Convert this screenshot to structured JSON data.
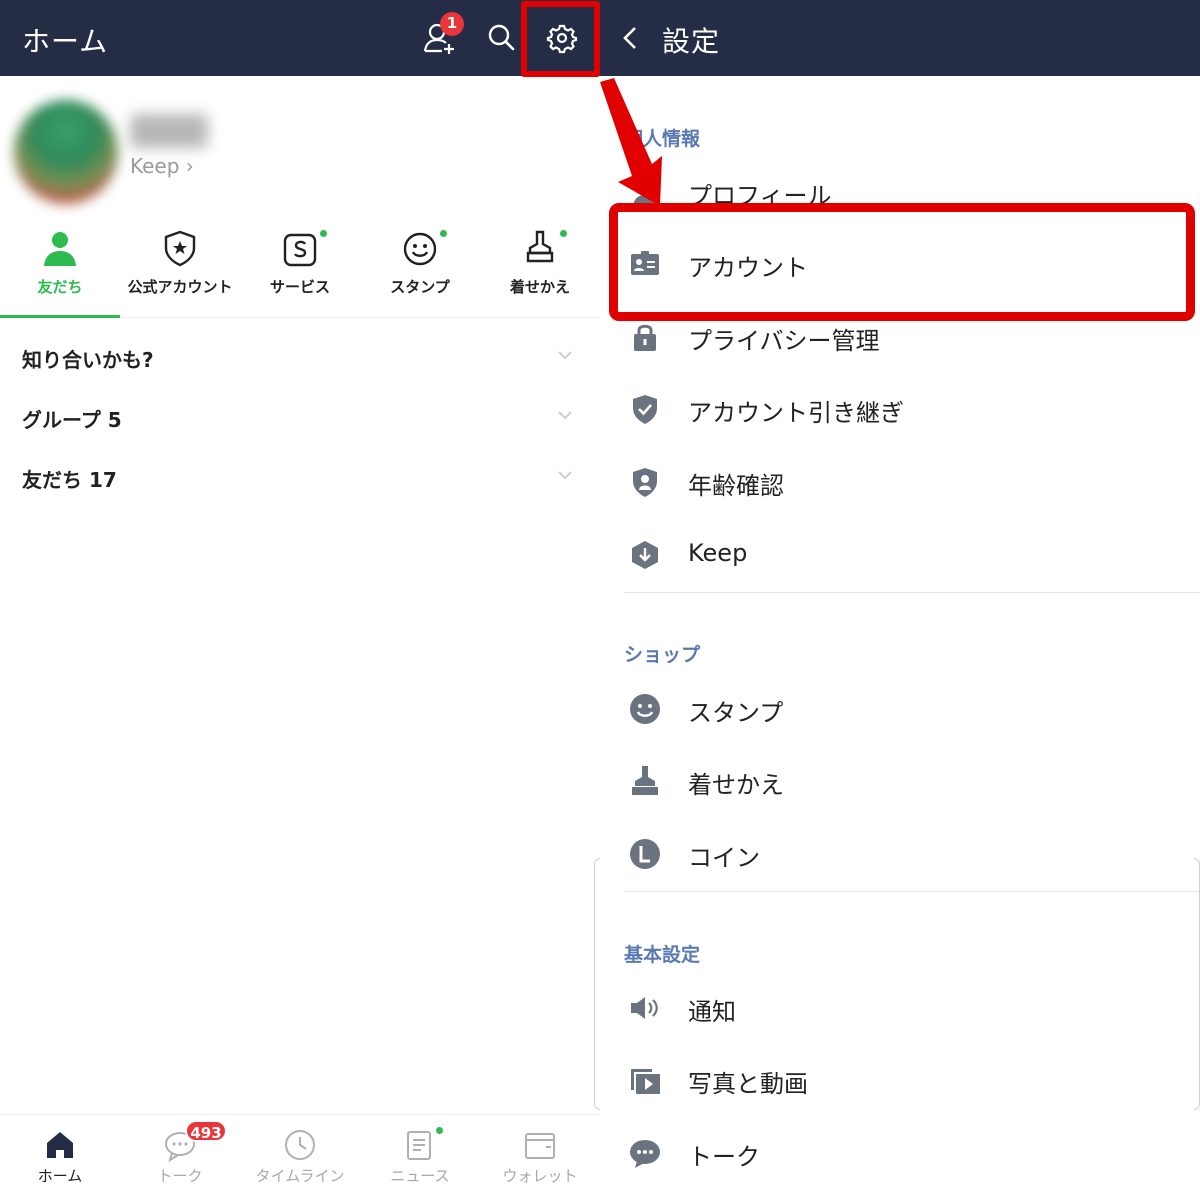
{
  "home": {
    "title": "ホーム",
    "add_friend_badge": "1",
    "profile": {
      "keep_label": "Keep ›"
    },
    "tabs": [
      {
        "label": "友だち",
        "icon": "person-icon",
        "active": true,
        "dot": false
      },
      {
        "label": "公式アカウント",
        "icon": "shield-star-icon",
        "active": false,
        "dot": false
      },
      {
        "label": "サービス",
        "icon": "service-s-icon",
        "active": false,
        "dot": true
      },
      {
        "label": "スタンプ",
        "icon": "smiley-icon",
        "active": false,
        "dot": true
      },
      {
        "label": "着せかえ",
        "icon": "brush-icon",
        "active": false,
        "dot": true
      }
    ],
    "sections": [
      {
        "label": "知り合いかも?"
      },
      {
        "label": "グループ 5"
      },
      {
        "label": "友だち 17"
      }
    ],
    "bottom_nav": [
      {
        "label": "ホーム",
        "icon": "home-icon",
        "active": true
      },
      {
        "label": "トーク",
        "icon": "chat-bubble-icon",
        "active": false
      },
      {
        "label": "タイムライン",
        "icon": "clock-icon",
        "active": false
      },
      {
        "label": "ニュース",
        "icon": "news-icon",
        "active": false
      },
      {
        "label": "ウォレット",
        "icon": "wallet-icon",
        "active": false
      }
    ],
    "talk_badge": "493"
  },
  "settings": {
    "title": "設定",
    "groups": [
      {
        "header": "個人情報",
        "items": [
          {
            "label": "プロフィール",
            "icon": "person-icon"
          },
          {
            "label": "アカウント",
            "icon": "id-card-icon"
          },
          {
            "label": "プライバシー管理",
            "icon": "lock-icon"
          },
          {
            "label": "アカウント引き継ぎ",
            "icon": "shield-check-icon"
          },
          {
            "label": "年齢確認",
            "icon": "shield-person-icon"
          },
          {
            "label": "Keep",
            "icon": "keep-icon"
          }
        ]
      },
      {
        "header": "ショップ",
        "items": [
          {
            "label": "スタンプ",
            "icon": "smiley-icon"
          },
          {
            "label": "着せかえ",
            "icon": "brush-icon"
          },
          {
            "label": "コイン",
            "icon": "coin-icon"
          }
        ]
      },
      {
        "header": "基本設定",
        "items": [
          {
            "label": "通知",
            "icon": "speaker-icon"
          },
          {
            "label": "写真と動画",
            "icon": "photo-video-icon"
          },
          {
            "label": "トーク",
            "icon": "chat-bubble-icon"
          }
        ]
      }
    ]
  },
  "colors": {
    "header_bg": "#252c45",
    "accent_green": "#2fba4f",
    "group_header_blue": "#5a79b2",
    "highlight_red": "#e10000",
    "badge_red": "#e8363b",
    "icon_gray": "#6b7280"
  }
}
